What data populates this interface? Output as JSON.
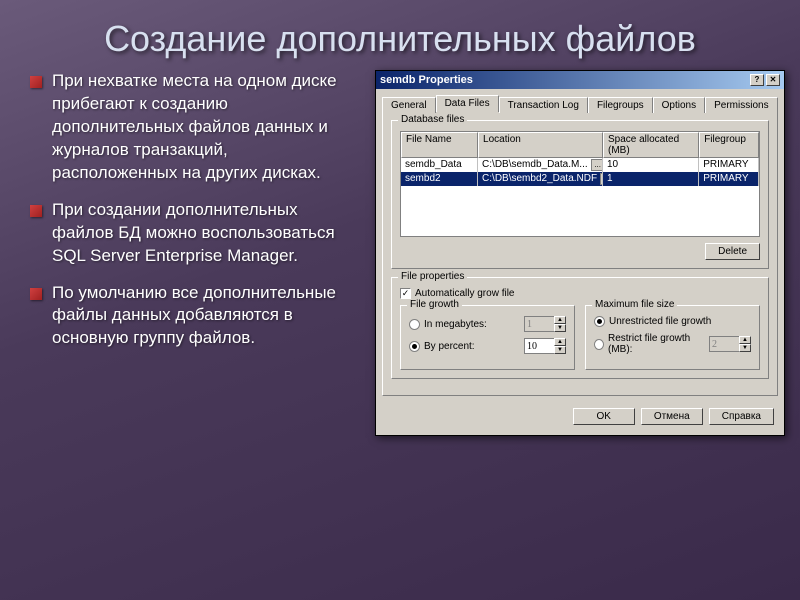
{
  "slide": {
    "title": "Создание дополнительных файлов",
    "bullets": [
      "При нехватке места на одном диске прибегают к созданию дополнительных файлов данных и журналов транзакций, расположенных на других дисках.",
      "При создании дополнительных файлов БД можно воспользоваться SQL Server Enterprise Manager.",
      "По умолчанию все дополнительные файлы данных добавляются в основную группу файлов."
    ]
  },
  "dialog": {
    "title": "semdb Properties",
    "tabs": [
      "General",
      "Data Files",
      "Transaction Log",
      "Filegroups",
      "Options",
      "Permissions"
    ],
    "active_tab": 1,
    "db_files_label": "Database files",
    "columns": [
      "File Name",
      "Location",
      "Space allocated (MB)",
      "Filegroup"
    ],
    "rows": [
      {
        "name": "semdb_Data",
        "location": "C:\\DB\\semdb_Data.M...",
        "space": "10",
        "group": "PRIMARY",
        "selected": false
      },
      {
        "name": "sembd2",
        "location": "C:\\DB\\sembd2_Data.NDF",
        "space": "1",
        "group": "PRIMARY",
        "selected": true
      }
    ],
    "delete_label": "Delete",
    "file_props": {
      "legend": "File properties",
      "auto_grow_label": "Automatically grow file",
      "auto_grow_checked": true,
      "growth": {
        "legend": "File growth",
        "megabytes_label": "In megabytes:",
        "megabytes_value": "1",
        "percent_label": "By percent:",
        "percent_value": "10",
        "selected": "percent"
      },
      "max": {
        "legend": "Maximum file size",
        "unrestricted_label": "Unrestricted file growth",
        "restrict_label": "Restrict file growth (MB):",
        "restrict_value": "2",
        "selected": "unrestricted"
      }
    },
    "buttons": {
      "ok": "OK",
      "cancel": "Отмена",
      "help": "Справка"
    }
  }
}
